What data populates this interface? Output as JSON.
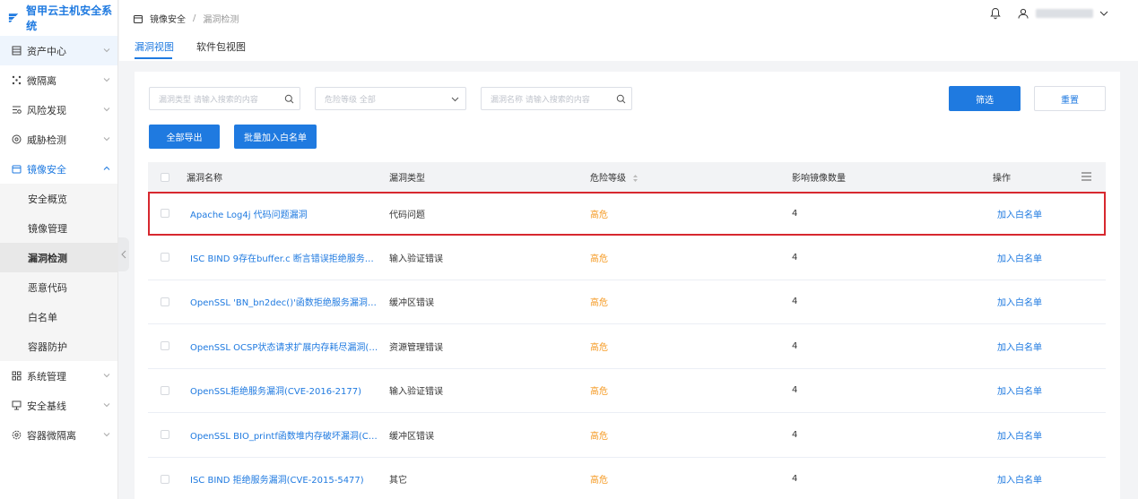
{
  "app": {
    "title": "智甲云主机安全系统"
  },
  "sidebar": {
    "items": [
      {
        "label": "资产中心",
        "icon": "list-icon"
      },
      {
        "label": "微隔离",
        "icon": "grid-dots-icon"
      },
      {
        "label": "风险发现",
        "icon": "scan-icon"
      },
      {
        "label": "威胁检测",
        "icon": "target-icon"
      },
      {
        "label": "镜像安全",
        "icon": "image-box-icon"
      },
      {
        "label": "系统管理",
        "icon": "apps-icon"
      },
      {
        "label": "安全基线",
        "icon": "monitor-icon"
      },
      {
        "label": "容器微隔离",
        "icon": "shield-gear-icon"
      }
    ],
    "sub_items": [
      "安全概览",
      "镜像管理",
      "漏洞检测",
      "恶意代码",
      "白名单",
      "容器防护"
    ]
  },
  "breadcrumb": {
    "parent": "镜像安全",
    "separator": "/",
    "current": "漏洞检测"
  },
  "tabs": [
    "漏洞视图",
    "软件包视图"
  ],
  "filters": {
    "vuln_type_placeholder": "漏洞类型 请输入搜索的内容",
    "risk_level_placeholder": "危险等级 全部",
    "vuln_name_placeholder": "漏洞名称 请输入搜索的内容"
  },
  "buttons": {
    "filter": "筛选",
    "reset": "重置",
    "export_all": "全部导出",
    "batch_whitelist": "批量加入白名单"
  },
  "table": {
    "headers": [
      "漏洞名称",
      "漏洞类型",
      "危险等级",
      "影响镜像数量",
      "操作"
    ],
    "rows": [
      {
        "name": "Apache Log4j 代码问题漏洞",
        "type": "代码问题",
        "risk": "高危",
        "count": "4",
        "action": "加入白名单"
      },
      {
        "name": "ISC BIND 9存在buffer.c 断言错误拒绝服务漏洞(...",
        "type": "输入验证错误",
        "risk": "高危",
        "count": "4",
        "action": "加入白名单"
      },
      {
        "name": "OpenSSL 'BN_bn2dec()'函数拒绝服务漏洞(CVE-...",
        "type": "缓冲区错误",
        "risk": "高危",
        "count": "4",
        "action": "加入白名单"
      },
      {
        "name": "OpenSSL OCSP状态请求扩展内存耗尽漏洞(CVE...",
        "type": "资源管理错误",
        "risk": "高危",
        "count": "4",
        "action": "加入白名单"
      },
      {
        "name": "OpenSSL拒绝服务漏洞(CVE-2016-2177)",
        "type": "输入验证错误",
        "risk": "高危",
        "count": "4",
        "action": "加入白名单"
      },
      {
        "name": "OpenSSL BIO_printf函数堆内存破坏漏洞(CVE-2...",
        "type": "缓冲区错误",
        "risk": "高危",
        "count": "4",
        "action": "加入白名单"
      },
      {
        "name": "ISC BIND 拒绝服务漏洞(CVE-2015-5477)",
        "type": "其它",
        "risk": "高危",
        "count": "4",
        "action": "加入白名单"
      }
    ]
  },
  "colors": {
    "accent": "#1f7ae0",
    "risk_high": "#f59a23",
    "selection": "#d7282f"
  }
}
